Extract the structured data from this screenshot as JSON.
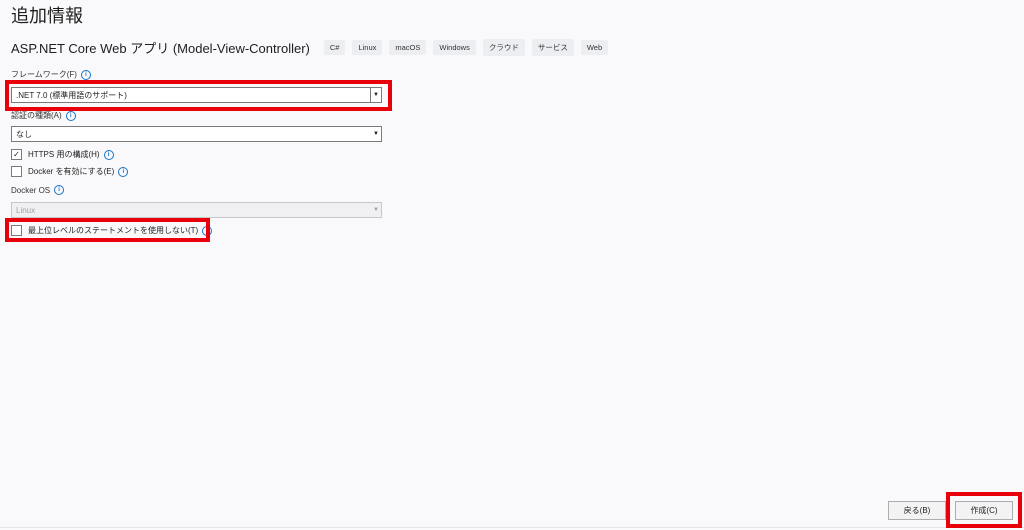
{
  "page": {
    "title": "追加情報"
  },
  "project": {
    "name": "ASP.NET Core Web アプリ (Model-View-Controller)",
    "tags": [
      "C#",
      "Linux",
      "macOS",
      "Windows",
      "クラウド",
      "サービス",
      "Web"
    ]
  },
  "framework": {
    "label": "フレームワーク(F)",
    "value": ".NET 7.0 (標準用語のサポート)"
  },
  "auth": {
    "label": "認証の種類(A)",
    "value": "なし"
  },
  "https": {
    "label": "HTTPS 用の構成(H)",
    "checked": true,
    "check_glyph": "✓"
  },
  "docker": {
    "label": "Docker を有効にする(E)",
    "checked": false
  },
  "docker_os": {
    "label": "Docker OS",
    "value": "Linux",
    "disabled": true
  },
  "top_level": {
    "label": "最上位レベルのステートメントを使用しない(T)",
    "checked": false
  },
  "icons": {
    "info": "i",
    "dropdown": "▼"
  },
  "buttons": {
    "back": "戻る(B)",
    "create": "作成(C)"
  },
  "colors": {
    "highlight": "#e8000b",
    "info": "#1a73c6"
  }
}
